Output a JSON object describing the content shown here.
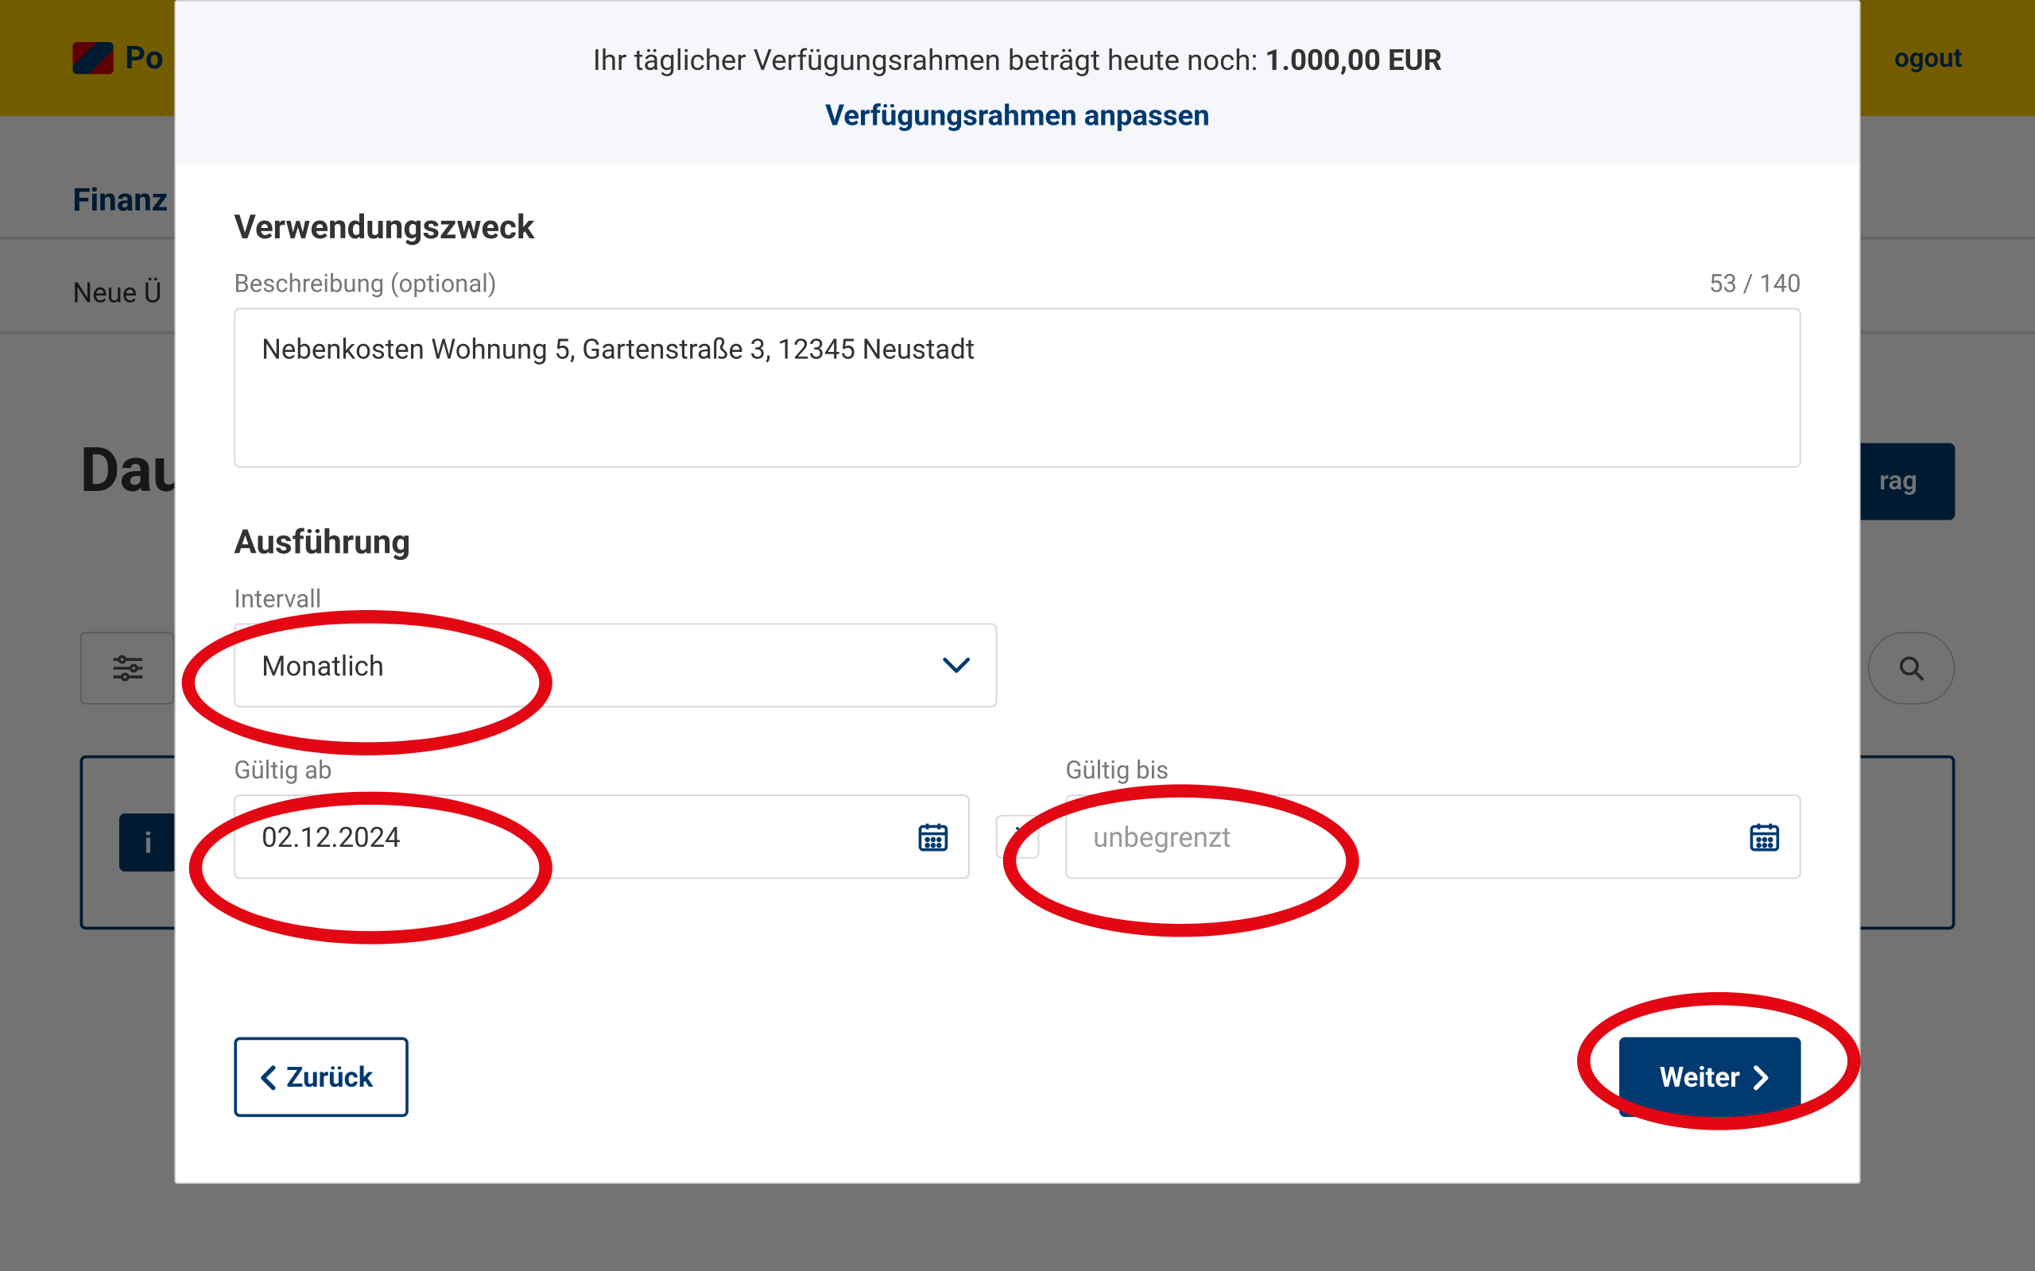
{
  "bg": {
    "brand": "Po",
    "logout": "ogout",
    "tab1": "Finanz",
    "tab2": "Neue Ü",
    "page_title": "Dau",
    "right_btn": "rag"
  },
  "limit": {
    "prefix": "Ihr täglicher Verfügungsrahmen beträgt heute noch: ",
    "amount": "1.000,00 EUR",
    "adjust": "Verfügungsrahmen anpassen"
  },
  "purpose": {
    "heading": "Verwendungszweck",
    "label": "Beschreibung (optional)",
    "counter": "53 / 140",
    "value": "Nebenkosten Wohnung 5, Gartenstraße 3, 12345 Neustadt"
  },
  "execution": {
    "heading": "Ausführung",
    "interval_label": "Intervall",
    "interval_value": "Monatlich",
    "from_label": "Gültig ab",
    "from_value": "02.12.2024",
    "to_label": "Gültig bis",
    "to_placeholder": "unbegrenzt"
  },
  "buttons": {
    "back": "Zurück",
    "next": "Weiter"
  },
  "icons": {
    "info": "i"
  }
}
